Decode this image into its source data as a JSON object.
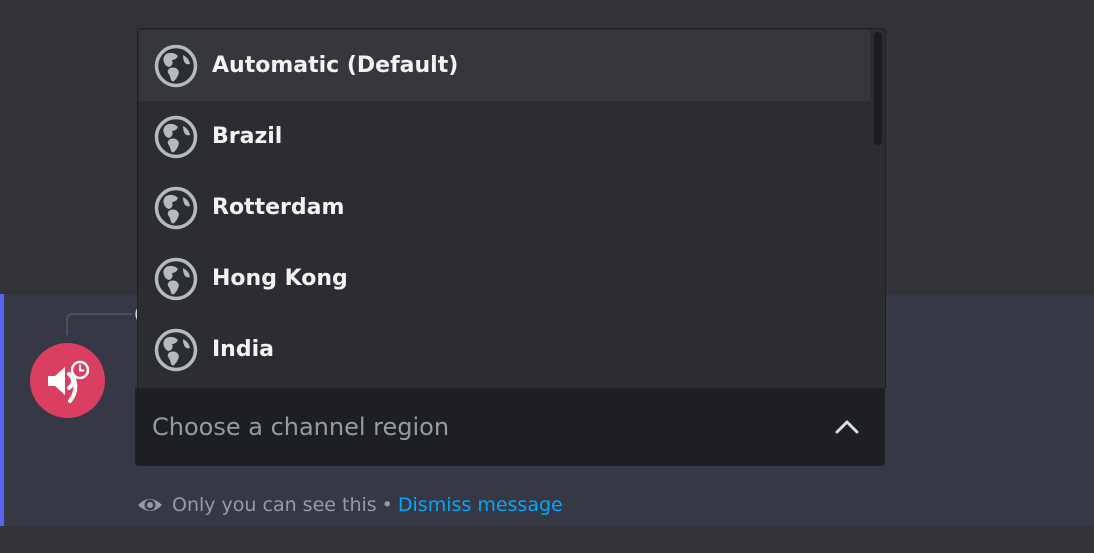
{
  "region_select": {
    "placeholder": "Choose a channel region",
    "options": [
      {
        "label": "Automatic (Default)",
        "icon": "globe-icon",
        "highlighted": true
      },
      {
        "label": "Brazil",
        "icon": "globe-icon"
      },
      {
        "label": "Rotterdam",
        "icon": "globe-icon"
      },
      {
        "label": "Hong Kong",
        "icon": "globe-icon"
      },
      {
        "label": "India",
        "icon": "globe-icon"
      }
    ]
  },
  "ephemeral_notice": {
    "text": "Only you can see this",
    "separator": "•",
    "dismiss_label": "Dismiss message"
  },
  "bot": {
    "avatar_icon": "speaker-clock-icon",
    "avatar_color": "#da3e60"
  },
  "colors": {
    "accent": "#5865f2",
    "link": "#00a8fc"
  }
}
